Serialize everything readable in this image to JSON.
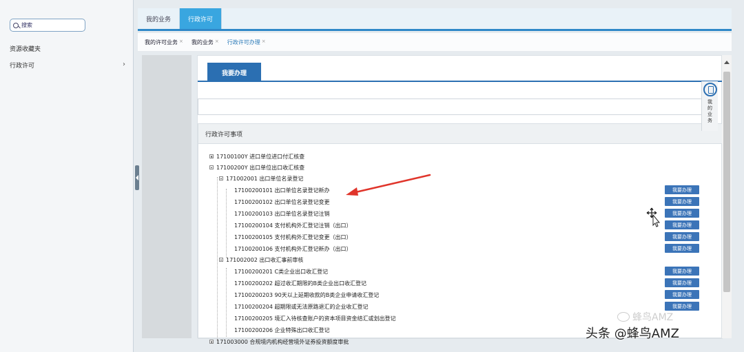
{
  "sidebar": {
    "search_label": "搜索",
    "favorites_label": "资源收藏夹",
    "permit_label": "行政许可"
  },
  "topbar": {
    "tabs": [
      {
        "label": "我的业务"
      },
      {
        "label": "行政许可"
      }
    ]
  },
  "breadcrumb": {
    "items": [
      {
        "label": "我的许可业务",
        "close": "×"
      },
      {
        "label": "我的业务",
        "close": "×"
      },
      {
        "label": "行政许可办理",
        "close": "×"
      }
    ]
  },
  "main": {
    "tab_label": "我要办理",
    "section_title": "行政许可事项",
    "tree": [
      {
        "label": "17100100Y 进口单位进口付汇核查"
      },
      {
        "label": "17100200Y 出口单位出口收汇核查"
      },
      {
        "label": "171002001 出口单位名录登记"
      },
      {
        "label": "17100200101 出口单位名录登记新办"
      },
      {
        "label": "17100200102 出口单位名录登记变更"
      },
      {
        "label": "17100200103 出口单位名录登记注销"
      },
      {
        "label": "17100200104 支付机构外汇登记注销（出口）"
      },
      {
        "label": "17100200105 支付机构外汇登记变更（出口）"
      },
      {
        "label": "17100200106 支付机构外汇登记新办（出口）"
      },
      {
        "label": "171002002 出口收汇事前审核"
      },
      {
        "label": "17100200201 C类企业出口收汇登记"
      },
      {
        "label": "17100200202 超过收汇期限的B类企业出口收汇登记"
      },
      {
        "label": "17100200203 90天以上延期收款的B类企业申请收汇登记"
      },
      {
        "label": "17100200204 超期限或无法原路退汇的企业收汇登记"
      },
      {
        "label": "17100200205 境汇入待核查账户的资本项目资金结汇或划出登记"
      },
      {
        "label": "17100200206 企业特殊出口收汇登记"
      },
      {
        "label": "171003000 合规境内机构经营境外证券投资额度审批"
      }
    ],
    "action_label": "我要办理"
  },
  "side_widget": {
    "label": "我的业务"
  },
  "watermark": {
    "small": "蜂鸟AMZ",
    "main": "头条 @蜂鸟AMZ"
  }
}
